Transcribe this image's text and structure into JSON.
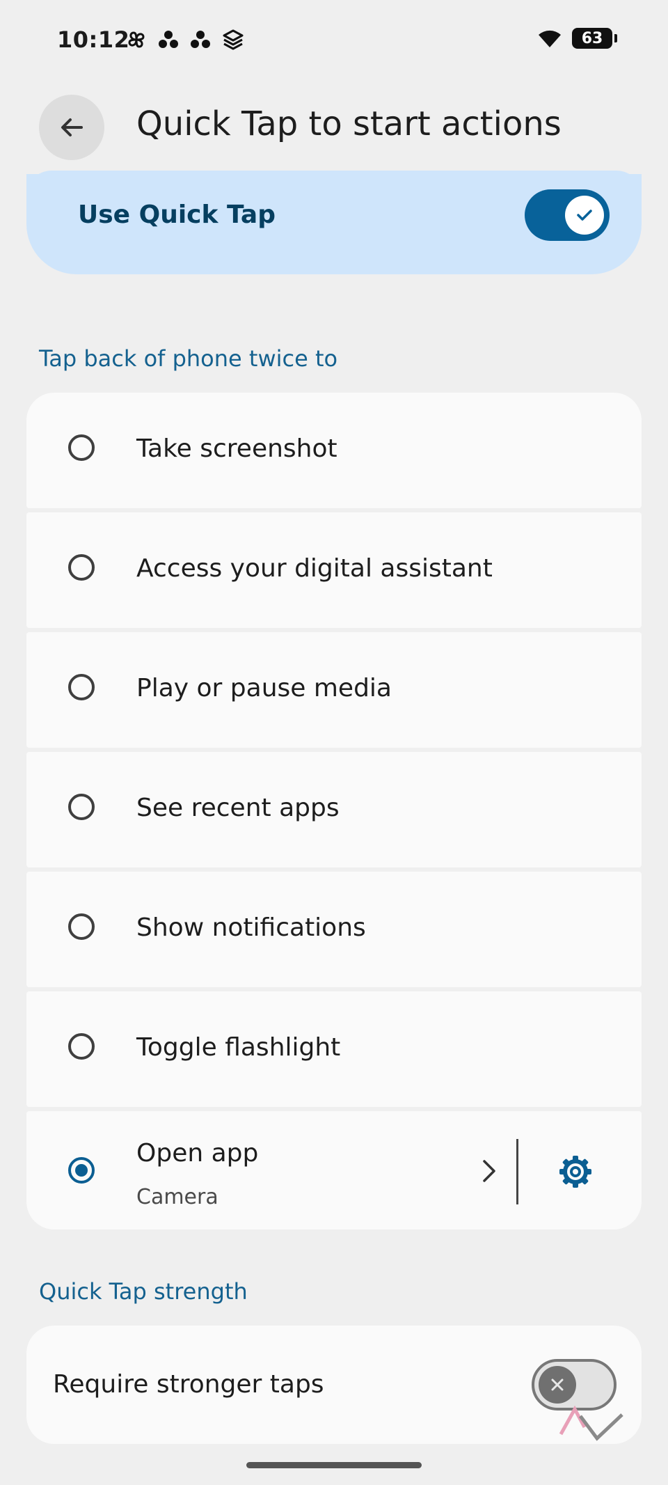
{
  "status_bar": {
    "time": "10:12",
    "battery": "63",
    "left_icons": [
      "pinwheel-icon",
      "dots-icon",
      "dots-icon",
      "stack-icon"
    ],
    "right_icons": [
      "wifi-icon",
      "battery-icon"
    ]
  },
  "header": {
    "title": "Quick Tap to start actions"
  },
  "quick_tap": {
    "label": "Use Quick Tap",
    "enabled": true
  },
  "actions_section": {
    "title": "Tap back of phone twice to",
    "options": [
      {
        "label": "Take screenshot",
        "selected": false
      },
      {
        "label": "Access your digital assistant",
        "selected": false
      },
      {
        "label": "Play or pause media",
        "selected": false
      },
      {
        "label": "See recent apps",
        "selected": false
      },
      {
        "label": "Show notifications",
        "selected": false
      },
      {
        "label": "Toggle flashlight",
        "selected": false
      },
      {
        "label": "Open app",
        "sublabel": "Camera",
        "selected": true
      }
    ]
  },
  "strength_section": {
    "title": "Quick Tap strength",
    "label": "Require stronger taps",
    "enabled": false
  },
  "colors": {
    "accent": "#08629a",
    "card_highlight": "#cfe5fb",
    "section_title": "#14618f"
  }
}
